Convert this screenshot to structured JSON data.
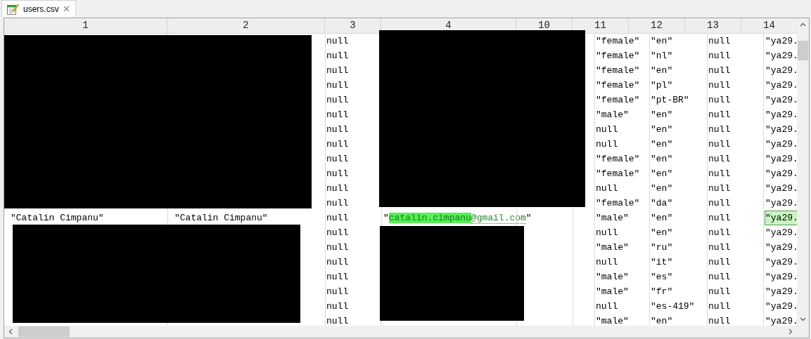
{
  "tabs": [
    {
      "label": "users.csv",
      "selected": true
    }
  ],
  "table": {
    "columns": [
      "1",
      "2",
      "3",
      "4",
      "10",
      "11",
      "12",
      "13",
      "14"
    ],
    "rows": [
      {
        "column_3": "null",
        "column_11": "\"female\"",
        "column_12": "\"en\"",
        "column_13": "null",
        "column_14": {
          "text": "\"ya29.",
          "selected": false
        }
      },
      {
        "column_3": "null",
        "column_11": "\"female\"",
        "column_12": "\"nl\"",
        "column_13": "null",
        "column_14": {
          "text": "\"ya29.",
          "selected": false
        }
      },
      {
        "column_3": "null",
        "column_11": "\"female\"",
        "column_12": "\"en\"",
        "column_13": "null",
        "column_14": {
          "text": "\"ya29.",
          "selected": false
        }
      },
      {
        "column_3": "null",
        "column_11": "\"female\"",
        "column_12": "\"pl\"",
        "column_13": "null",
        "column_14": {
          "text": "\"ya29.",
          "selected": false
        }
      },
      {
        "column_3": "null",
        "column_11": "\"female\"",
        "column_12": "\"pt-BR\"",
        "column_13": "null",
        "column_14": {
          "text": "\"ya29.",
          "selected": false
        }
      },
      {
        "column_3": "null",
        "column_11": "\"male\"",
        "column_12": "\"en\"",
        "column_13": "null",
        "column_14": {
          "text": "\"ya29.",
          "selected": false
        }
      },
      {
        "column_3": "null",
        "column_11": "null",
        "column_12": "\"en\"",
        "column_13": "null",
        "column_14": {
          "text": "\"ya29.",
          "selected": false
        }
      },
      {
        "column_3": "null",
        "column_11": "null",
        "column_12": "\"en\"",
        "column_13": "null",
        "column_14": {
          "text": "\"ya29.",
          "selected": false
        }
      },
      {
        "column_3": "null",
        "column_11": "\"female\"",
        "column_12": "\"en\"",
        "column_13": "null",
        "column_14": {
          "text": "\"ya29.",
          "selected": false
        }
      },
      {
        "column_3": "null",
        "column_11": "\"female\"",
        "column_12": "\"en\"",
        "column_13": "null",
        "column_14": {
          "text": "\"ya29.",
          "selected": false
        }
      },
      {
        "column_3": "null",
        "column_11": "null",
        "column_12": "\"en\"",
        "column_13": "null",
        "column_14": {
          "text": "\"ya29.",
          "selected": false
        }
      },
      {
        "column_3": "null",
        "column_11": "\"female\"",
        "column_12": "\"da\"",
        "column_13": "null",
        "column_14": {
          "text": "\"ya29.",
          "selected": false
        }
      },
      {
        "column_1": "\"Catalin Cimpanu\"",
        "column_2": "\"Catalin Cimpanu\"",
        "column_3": "null",
        "column_4": [
          {
            "text": "\"",
            "kind": "plain"
          },
          {
            "text": "catalin.cimpanu",
            "kind": "match"
          },
          {
            "text": "@gmail.com",
            "kind": "link"
          },
          {
            "text": "\"",
            "kind": "plain"
          }
        ],
        "column_11": "\"male\"",
        "column_12": "\"en\"",
        "column_13": "null",
        "column_14": {
          "text": "\"ya29.",
          "selected": true
        }
      },
      {
        "column_3": "null",
        "column_11": "null",
        "column_12": "\"en\"",
        "column_13": "null",
        "column_14": {
          "text": "\"ya29.",
          "selected": false
        }
      },
      {
        "column_3": "null",
        "column_11": "\"male\"",
        "column_12": "\"ru\"",
        "column_13": "null",
        "column_14": {
          "text": "\"ya29.",
          "selected": false
        }
      },
      {
        "column_3": "null",
        "column_11": "null",
        "column_12": "\"it\"",
        "column_13": "null",
        "column_14": {
          "text": "\"ya29.",
          "selected": false
        }
      },
      {
        "column_3": "null",
        "column_11": "\"male\"",
        "column_12": "\"es\"",
        "column_13": "null",
        "column_14": {
          "text": "\"ya29.",
          "selected": false
        }
      },
      {
        "column_3": "null",
        "column_11": "\"male\"",
        "column_12": "\"fr\"",
        "column_13": "null",
        "column_14": {
          "text": "\"ya29.",
          "selected": false
        }
      },
      {
        "column_3": "null",
        "column_11": "null",
        "column_12": "\"es-419\"",
        "column_13": "null",
        "column_14": {
          "text": "\"ya29.",
          "selected": false
        }
      },
      {
        "column_3": "null",
        "column_11": "\"male\"",
        "column_12": "\"en\"",
        "column_13": "null",
        "column_14": {
          "text": "\"ya29.",
          "selected": false
        }
      }
    ]
  }
}
